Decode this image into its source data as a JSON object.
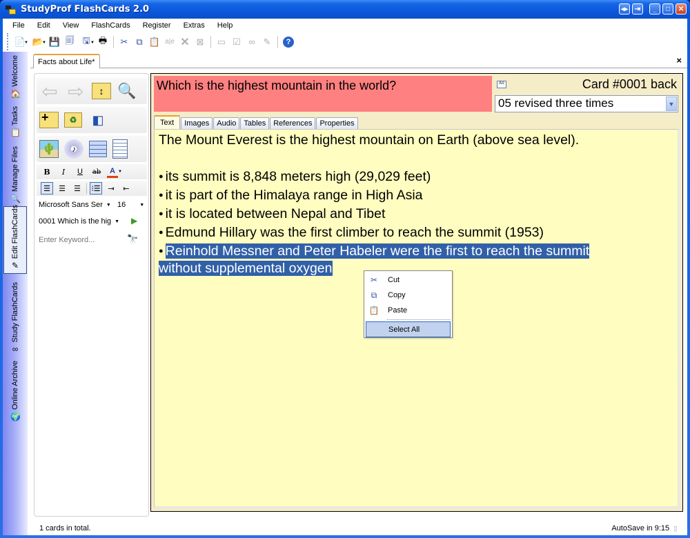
{
  "window": {
    "title": "StudyProf FlashCards 2.0",
    "controls": [
      "restore-layout",
      "export",
      "minimize",
      "maximize",
      "close"
    ]
  },
  "menu": [
    "File",
    "Edit",
    "View",
    "FlashCards",
    "Register",
    "Extras",
    "Help"
  ],
  "toolbar": [
    {
      "name": "new",
      "icon": "📄",
      "dropdown": true
    },
    {
      "name": "open",
      "icon": "📂",
      "dropdown": true
    },
    {
      "name": "save",
      "icon": "💾"
    },
    {
      "name": "save-all",
      "icon": "🗐"
    },
    {
      "name": "save-as",
      "icon": "🖫",
      "dropdown": true
    },
    {
      "name": "print",
      "icon": "🖶"
    },
    {
      "name": "cut",
      "icon": "✂"
    },
    {
      "name": "copy",
      "icon": "⧉"
    },
    {
      "name": "paste",
      "icon": "📋"
    },
    {
      "name": "spellcheck",
      "icon": "a|e",
      "disabled": true
    },
    {
      "name": "delete",
      "icon": "✕",
      "disabled": true
    },
    {
      "name": "clear-format",
      "icon": "⊠",
      "disabled": true
    },
    {
      "name": "folder",
      "icon": "▭",
      "disabled": true
    },
    {
      "name": "clipboard",
      "icon": "☑",
      "disabled": true
    },
    {
      "name": "study",
      "icon": "∞",
      "disabled": true
    },
    {
      "name": "edit",
      "icon": "✎",
      "disabled": true
    },
    {
      "name": "help",
      "icon": "?"
    }
  ],
  "sidebar": [
    {
      "label": "Welcome",
      "icon": "🏠"
    },
    {
      "label": "Tasks",
      "icon": "📋"
    },
    {
      "label": "Manage Files",
      "icon": "🔍"
    },
    {
      "label": "Edit FlashCards",
      "icon": "✎",
      "active": true
    },
    {
      "label": "Study FlashCards",
      "icon": "∞"
    },
    {
      "label": "Online Archive",
      "icon": "🌍"
    }
  ],
  "document_tab": {
    "label": "Facts about Life*",
    "close": "×"
  },
  "left_panel": {
    "font_name": "Microsoft Sans Ser",
    "font_size": "16",
    "card_select": "0001 Which is the hig",
    "keyword_placeholder": "Enter Keyword..."
  },
  "card": {
    "question": "Which is the highest mountain in the world?",
    "id_label": "Card #0001 back",
    "status": "05 revised three times",
    "tabs": [
      "Text",
      "Images",
      "Audio",
      "Tables",
      "References",
      "Properties"
    ],
    "active_tab": "Text",
    "body": {
      "intro": "The Mount Everest is the highest mountain on Earth (above sea level).",
      "bullets": [
        "its summit is 8,848 meters high (29,029 feet)",
        "it is part of the Himalaya range in High Asia",
        "it is located between Nepal and Tibet",
        "Edmund Hillary was the first climber to reach the summit (1953)"
      ],
      "selected_bullet_line1": "Reinhold Messner and Peter Habeler were the first to reach the summit ",
      "selected_bullet_line2": "without supplemental oxygen"
    }
  },
  "context_menu": {
    "items": [
      {
        "label": "Cut",
        "icon": "✂"
      },
      {
        "label": "Copy",
        "icon": "⧉"
      },
      {
        "label": "Paste",
        "icon": "📋"
      }
    ],
    "select_all": "Select All"
  },
  "status": {
    "left": "1 cards in total.",
    "right": "AutoSave in 9:15"
  },
  "colors": {
    "question_bg": "#ff8080",
    "editor_bg": "#fffdc0",
    "selection": "#3160a8",
    "tab_accent": "#e8a030"
  }
}
